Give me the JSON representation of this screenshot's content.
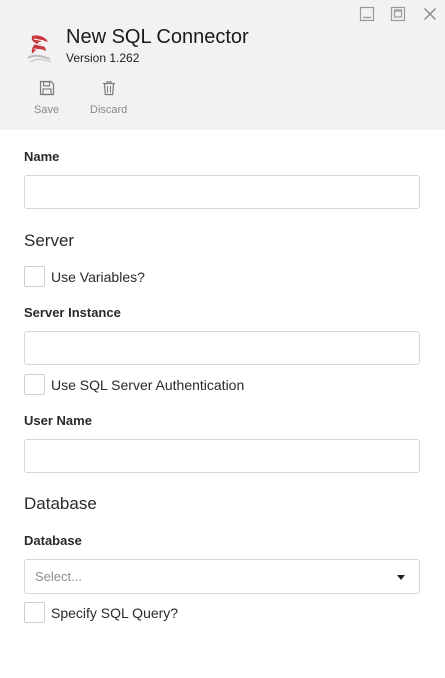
{
  "window": {
    "title": "New SQL Connector",
    "version": "Version 1.262",
    "controls": [
      "minimize-icon",
      "restore-icon",
      "close-icon"
    ]
  },
  "toolbar": {
    "save_label": "Save",
    "discard_label": "Discard",
    "save_icon": "floppy-disk-icon",
    "discard_icon": "trash-icon"
  },
  "form": {
    "name_label": "Name",
    "name_value": "",
    "server_heading": "Server",
    "use_variables_label": "Use Variables?",
    "use_variables_checked": false,
    "server_instance_label": "Server Instance",
    "server_instance_value": "",
    "sql_auth_label": "Use SQL Server Authentication",
    "sql_auth_checked": false,
    "user_name_label": "User Name",
    "user_name_value": "",
    "database_heading": "Database",
    "database_label": "Database",
    "database_placeholder": "Select...",
    "specify_query_label": "Specify SQL Query?",
    "specify_query_checked": false
  },
  "colors": {
    "header_bg": "#f2f2f2",
    "logo_red": "#c8393d",
    "icon_gray": "#8a8a8a",
    "border": "#d7d7d7"
  }
}
